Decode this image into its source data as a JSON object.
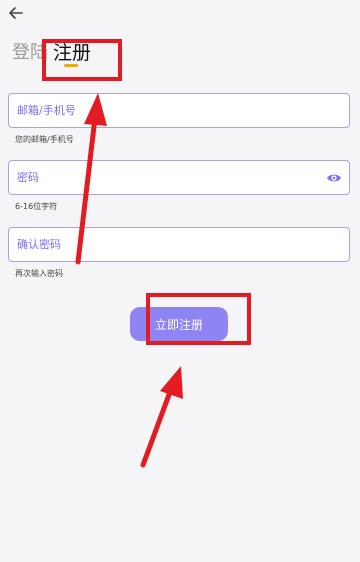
{
  "header": {
    "back_icon": "arrow-left-icon",
    "tabs": {
      "login": "登陆",
      "register": "注册"
    }
  },
  "form": {
    "email": {
      "placeholder": "邮箱/手机号",
      "hint": "您的邮箱/手机号"
    },
    "password": {
      "placeholder": "密码",
      "hint": "6-16位字符",
      "icon": "eye-icon"
    },
    "confirm_password": {
      "placeholder": "确认密码",
      "hint": "再次输入密码"
    },
    "submit_label": "立即注册"
  },
  "colors": {
    "accent": "#8f84f4",
    "field_border": "#a8a4e0",
    "placeholder": "#7b6cf6",
    "tab_indicator": "#f2a900",
    "annotation": "#e31b23"
  }
}
